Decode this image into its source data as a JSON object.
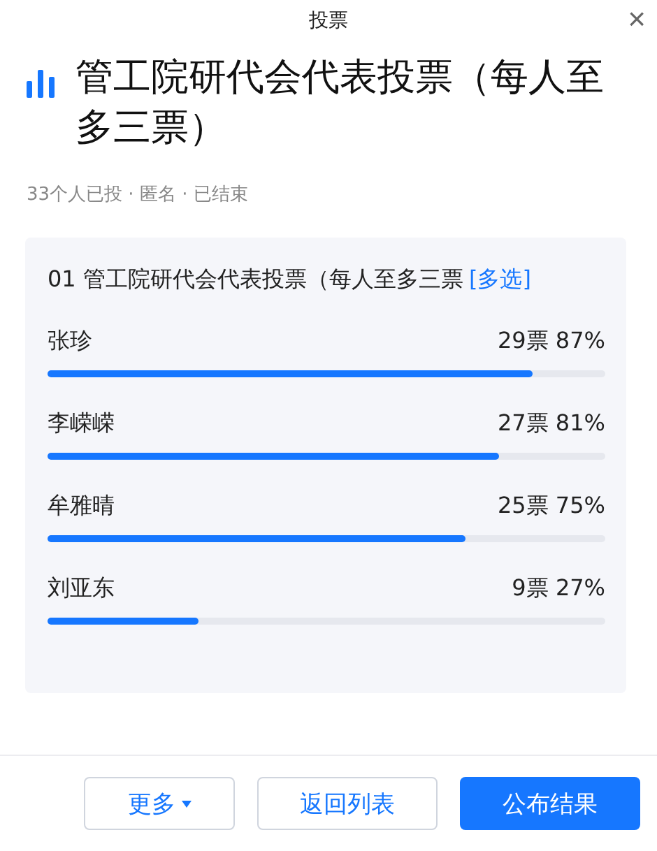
{
  "window": {
    "title": "投票",
    "close": "×"
  },
  "poll": {
    "title": "管工院研代会代表投票（每人至多三票）",
    "meta": "33个人已投 · 匿名 · 已结束"
  },
  "question": {
    "number": "01",
    "text": "管工院研代会代表投票（每人至多三票",
    "tag": "[多选]",
    "options": [
      {
        "name": "张珍",
        "result": "29票 87%",
        "level": 0.87
      },
      {
        "name": "李嵘嵘",
        "result": "27票 81%",
        "level": 0.81
      },
      {
        "name": "牟雅晴",
        "result": "25票 75%",
        "level": 0.75
      },
      {
        "name": "刘亚东",
        "result": "9票 27%",
        "level": 0.27
      }
    ]
  },
  "buttons": [
    {
      "label": "更多",
      "kind": "dropdown"
    },
    {
      "label": "返回列表",
      "kind": "secondary"
    },
    {
      "label": "公布结果",
      "kind": "primary"
    }
  ]
}
